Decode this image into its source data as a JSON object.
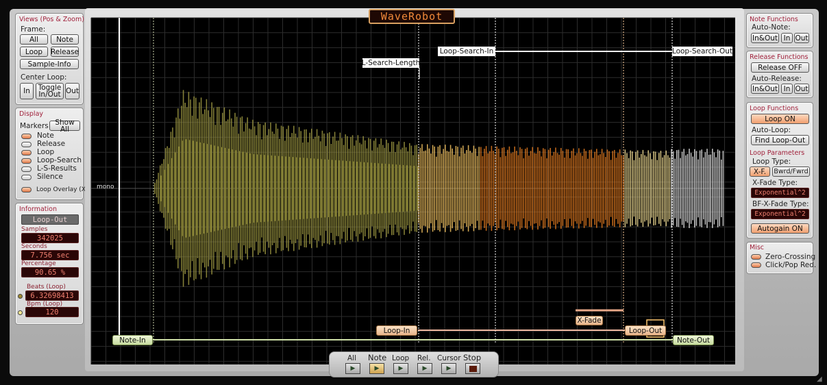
{
  "app": {
    "title": "WaveRobot"
  },
  "views": {
    "title": "Views (Pos & Zoom)",
    "frame_label": "Frame:",
    "all": "All",
    "note": "Note",
    "loop": "Loop",
    "release": "Release",
    "sample_info": "Sample-Info",
    "center_loop_label": "Center Loop:",
    "in": "In",
    "toggle_a": "Toggle",
    "toggle_b": "In/Out",
    "out": "Out"
  },
  "display": {
    "title": "Display",
    "markers_label": "Markers",
    "show_all": "Show All",
    "items": [
      {
        "label": "Note",
        "on": true
      },
      {
        "label": "Release",
        "on": false
      },
      {
        "label": "Loop",
        "on": true
      },
      {
        "label": "Loop-Search",
        "on": true
      },
      {
        "label": "L-S-Results",
        "on": false
      },
      {
        "label": "Silence",
        "on": false
      }
    ],
    "loop_overlay": "Loop Overlay (XF)"
  },
  "info": {
    "title": "Information",
    "marker": "Loop-Out",
    "samples_label": "Samples",
    "samples": "342025",
    "seconds_label": "Seconds",
    "seconds": "7.756 sec",
    "percentage_label": "Percentage",
    "percentage": "90.65 %",
    "beats_label": "Beats (Loop)",
    "beats": "6.32698413",
    "bpm_label": "Bpm (Loop)",
    "bpm": "120"
  },
  "note_functions": {
    "title": "Note Functions",
    "auto_label": "Auto-Note:",
    "inout": "In&Out",
    "in": "In",
    "out": "Out"
  },
  "release_functions": {
    "title": "Release Functions",
    "release_off": "Release OFF",
    "auto_label": "Auto-Release:",
    "inout": "In&Out",
    "in": "In",
    "out": "Out"
  },
  "loop_functions": {
    "title": "Loop Functions",
    "loop_on": "Loop ON",
    "auto_label": "Auto-Loop:",
    "find": "Find Loop-Out",
    "params_title": "Loop Parameters",
    "type_label": "Loop Type:",
    "xf": "X-F.",
    "bwrd": "Bwrd/Fwrd",
    "xfade_type_label": "X-Fade Type:",
    "xfade_type": "Exponential^2",
    "bf_type_label": "BF-X-Fade Type:",
    "bf_type": "Exponential^2",
    "autogain": "Autogain ON"
  },
  "misc": {
    "title": "Misc",
    "zero": "Zero-Crossing",
    "click": "Click/Pop Red."
  },
  "waveform": {
    "channel": "mono",
    "markers": {
      "note_in": "Note-In",
      "note_out": "Note-Out",
      "loop_in": "Loop-In",
      "loop_out": "Loop-Out",
      "loop_search_in": "Loop-Search-In",
      "loop_search_out": "Loop-Search-Out",
      "l_search_length": "L-Search-Length",
      "x_fade": "X-Fade"
    }
  },
  "transport": {
    "all": "All",
    "note": "Note",
    "loop": "Loop",
    "rel": "Rel.",
    "cursor": "Cursor",
    "stop": "Stop"
  },
  "colors": {
    "accent": "#a0203a",
    "loop_region": "#e07a20",
    "waveform": "#a09a40"
  }
}
